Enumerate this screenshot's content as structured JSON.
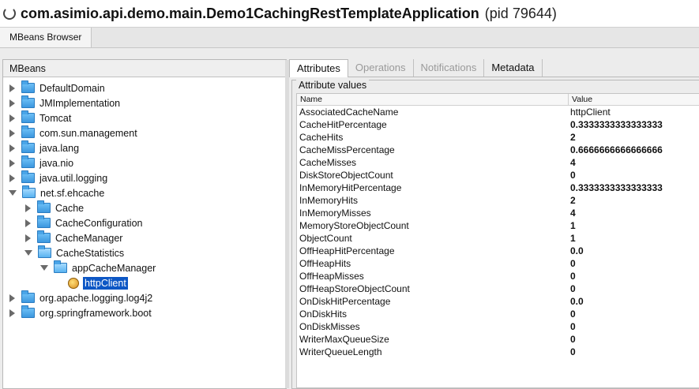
{
  "window": {
    "title": "com.asimio.api.demo.main.Demo1CachingRestTemplateApplication",
    "pid": "(pid 79644)"
  },
  "top_tab": {
    "label": "MBeans Browser"
  },
  "left_panel": {
    "header": "MBeans",
    "tree": [
      {
        "label": "DefaultDomain",
        "level": 0,
        "expanded": false
      },
      {
        "label": "JMImplementation",
        "level": 0,
        "expanded": false
      },
      {
        "label": "Tomcat",
        "level": 0,
        "expanded": false
      },
      {
        "label": "com.sun.management",
        "level": 0,
        "expanded": false
      },
      {
        "label": "java.lang",
        "level": 0,
        "expanded": false
      },
      {
        "label": "java.nio",
        "level": 0,
        "expanded": false
      },
      {
        "label": "java.util.logging",
        "level": 0,
        "expanded": false
      },
      {
        "label": "net.sf.ehcache",
        "level": 0,
        "expanded": true
      },
      {
        "label": "Cache",
        "level": 1,
        "expanded": false
      },
      {
        "label": "CacheConfiguration",
        "level": 1,
        "expanded": false
      },
      {
        "label": "CacheManager",
        "level": 1,
        "expanded": false
      },
      {
        "label": "CacheStatistics",
        "level": 1,
        "expanded": true
      },
      {
        "label": "appCacheManager",
        "level": 2,
        "expanded": true
      },
      {
        "label": "httpClient",
        "level": 3,
        "leaf": true,
        "selected": true
      },
      {
        "label": "org.apache.logging.log4j2",
        "level": 0,
        "expanded": false
      },
      {
        "label": "org.springframework.boot",
        "level": 0,
        "expanded": false
      }
    ]
  },
  "right_panel": {
    "tabs": [
      "Attributes",
      "Operations",
      "Notifications",
      "Metadata"
    ],
    "active_tab": "Attributes",
    "group_title": "Attribute values",
    "columns": [
      "Name",
      "Value"
    ],
    "rows": [
      {
        "name": "AssociatedCacheName",
        "value": "httpClient",
        "bold": false
      },
      {
        "name": "CacheHitPercentage",
        "value": "0.3333333333333333",
        "bold": true
      },
      {
        "name": "CacheHits",
        "value": "2",
        "bold": true
      },
      {
        "name": "CacheMissPercentage",
        "value": "0.6666666666666666",
        "bold": true
      },
      {
        "name": "CacheMisses",
        "value": "4",
        "bold": true
      },
      {
        "name": "DiskStoreObjectCount",
        "value": "0",
        "bold": true
      },
      {
        "name": "InMemoryHitPercentage",
        "value": "0.3333333333333333",
        "bold": true
      },
      {
        "name": "InMemoryHits",
        "value": "2",
        "bold": true
      },
      {
        "name": "InMemoryMisses",
        "value": "4",
        "bold": true
      },
      {
        "name": "MemoryStoreObjectCount",
        "value": "1",
        "bold": true
      },
      {
        "name": "ObjectCount",
        "value": "1",
        "bold": true
      },
      {
        "name": "OffHeapHitPercentage",
        "value": "0.0",
        "bold": true
      },
      {
        "name": "OffHeapHits",
        "value": "0",
        "bold": true
      },
      {
        "name": "OffHeapMisses",
        "value": "0",
        "bold": true
      },
      {
        "name": "OffHeapStoreObjectCount",
        "value": "0",
        "bold": true
      },
      {
        "name": "OnDiskHitPercentage",
        "value": "0.0",
        "bold": true
      },
      {
        "name": "OnDiskHits",
        "value": "0",
        "bold": true
      },
      {
        "name": "OnDiskMisses",
        "value": "0",
        "bold": true
      },
      {
        "name": "WriterMaxQueueSize",
        "value": "0",
        "bold": true
      },
      {
        "name": "WriterQueueLength",
        "value": "0",
        "bold": true
      }
    ]
  }
}
